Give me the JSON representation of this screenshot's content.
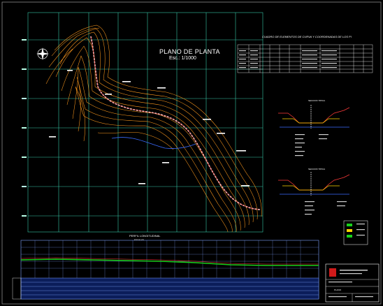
{
  "drawing": {
    "title": "PLANO DE PLANTA",
    "scale": "Esc.: 1/1000",
    "table_title": "CUADRO DE ELEMENTOS DE CURVA Y COORDENADAS DE LOS PI",
    "profile_title": "PERFIL LONGITUDINAL",
    "profile_subtitle": "ESCALAS",
    "section1_title": "SECCION TIPICA",
    "section2_title": "SECCION TIPICA",
    "title_block": "PLANO"
  },
  "colors": {
    "background": "#000000",
    "grid": "#37c8a8",
    "contours": "#ff9a1e",
    "road": "#ffffff",
    "profile_grid": "#7fa3ff",
    "ground_line": "#19d11b",
    "title_block_red": "#d11a1a"
  },
  "icons": [
    "north-arrow-icon"
  ]
}
